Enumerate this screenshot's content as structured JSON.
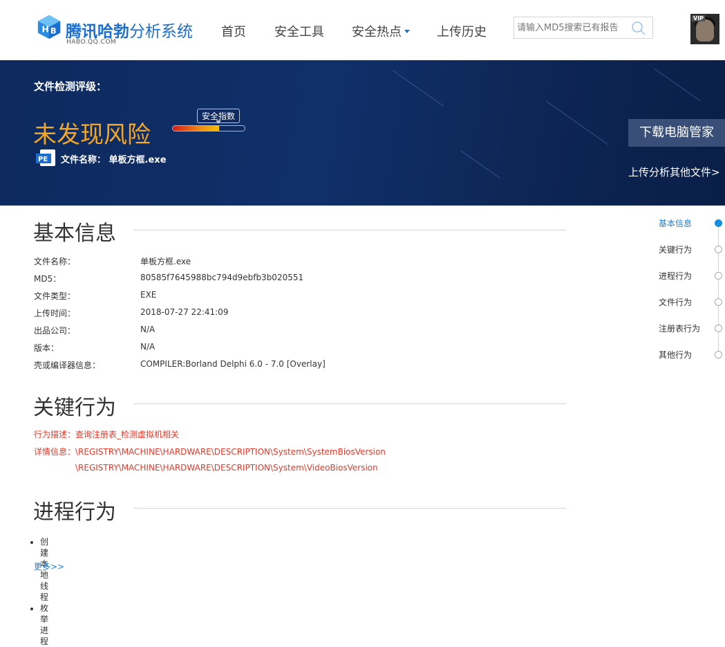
{
  "header": {
    "logo_brand": "腾讯哈勃",
    "logo_suffix": "分析系统",
    "logo_domain": "HABO.QQ.COM",
    "nav": [
      {
        "label": "首页"
      },
      {
        "label": "安全工具"
      },
      {
        "label": "安全热点",
        "has_dropdown": true
      },
      {
        "label": "上传历史"
      }
    ],
    "search": {
      "placeholder": "请输入MD5搜索已有报告",
      "value": "",
      "icon": "search-icon"
    },
    "avatar_badge": "VIP"
  },
  "banner": {
    "rating_label": "文件检测评级：",
    "risk_text": "未发现风险",
    "index_badge": "安全指数",
    "index_level": 0.64,
    "file_label": "文件名称：",
    "file_name": "单板方框.exe",
    "file_icon": "PE",
    "download_button": "下载电脑管家",
    "upload_link": "上传分析其他文件>"
  },
  "basic": {
    "title": "基本信息",
    "rows": [
      {
        "k": "文件名称：",
        "v": "单板方框.exe"
      },
      {
        "k": "MD5：",
        "v": "80585f7645988bc794d9ebfb3b020551"
      },
      {
        "k": "文件类型：",
        "v": "EXE"
      },
      {
        "k": "上传时间：",
        "v": "2018-07-27 22:41:09"
      },
      {
        "k": "出品公司：",
        "v": "N/A"
      },
      {
        "k": "版本：",
        "v": "N/A"
      },
      {
        "k": "壳或编译器信息：",
        "v": "COMPILER:Borland Delphi 6.0 - 7.0 [Overlay]"
      }
    ]
  },
  "key": {
    "title": "关键行为",
    "desc_label": "行为描述：",
    "desc": "查询注册表_检测虚拟机相关",
    "detail_label": "详情信息：",
    "details": [
      "\\REGISTRY\\MACHINE\\HARDWARE\\DESCRIPTION\\System\\SystemBiosVersion",
      "\\REGISTRY\\MACHINE\\HARDWARE\\DESCRIPTION\\System\\VideoBiosVersion"
    ]
  },
  "process": {
    "title": "进程行为",
    "items": [
      "创建本地线程",
      "枚举进程"
    ],
    "more": "更多>>"
  },
  "sidenav": {
    "items": [
      {
        "label": "基本信息",
        "active": true
      },
      {
        "label": "关键行为",
        "active": false
      },
      {
        "label": "进程行为",
        "active": false
      },
      {
        "label": "文件行为",
        "active": false
      },
      {
        "label": "注册表行为",
        "active": false
      },
      {
        "label": "其他行为",
        "active": false
      }
    ]
  },
  "colors": {
    "brand_blue": "#1a6fd0",
    "banner_bg": "#10306a",
    "risk_orange": "#f5a623",
    "behavior_red": "#e03a2b",
    "link_blue": "#1a7fd4"
  }
}
